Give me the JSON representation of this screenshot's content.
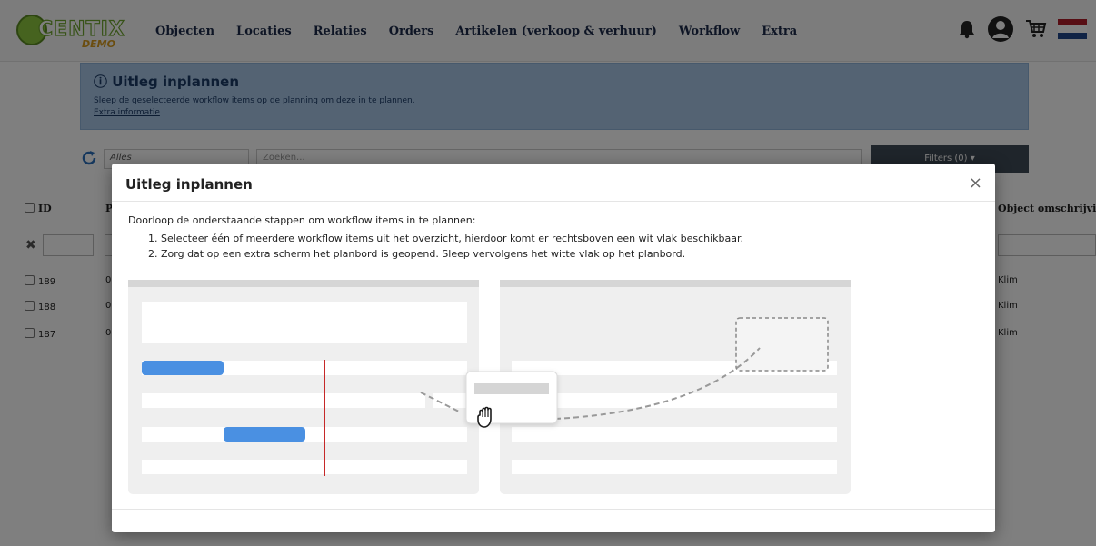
{
  "app": {
    "logo_text": "CENTIX",
    "logo_sub": "DEMO"
  },
  "nav": {
    "items": [
      {
        "label": "Objecten"
      },
      {
        "label": "Locaties"
      },
      {
        "label": "Relaties"
      },
      {
        "label": "Orders"
      },
      {
        "label": "Artikelen (verkoop & verhuur)"
      },
      {
        "label": "Workflow"
      },
      {
        "label": "Extra"
      }
    ],
    "icons": [
      "bell-icon",
      "user-avatar-icon",
      "cart-icon",
      "dutch-flag-icon"
    ]
  },
  "info": {
    "title": "Uitleg inplannen",
    "text": "Sleep de geselecteerde workflow items op de planning om deze in te plannen.",
    "link": "Extra informatie"
  },
  "toolbar": {
    "select_value": "Alles",
    "search_placeholder": "Zoeken...",
    "filters_label": "Filters (0) ▾"
  },
  "table": {
    "headers": {
      "id": "ID",
      "p": "P",
      "object": "Object omschrijvir"
    },
    "rows": [
      {
        "id": "189",
        "p": "0",
        "object": "Klim"
      },
      {
        "id": "188",
        "p": "0",
        "object": "Klim"
      },
      {
        "id": "187",
        "p": "0",
        "object": "Klim"
      }
    ]
  },
  "modal": {
    "title": "Uitleg inplannen",
    "close": "×",
    "intro": "Doorloop de onderstaande stappen om workflow items in te plannen:",
    "steps": [
      "1. Selecteer één of meerdere workflow items uit het overzicht, hierdoor komt er rechtsboven een wit vlak beschikbaar.",
      "2. Zorg dat op een extra scherm het planbord is geopend. Sleep vervolgens het witte vlak op het planbord."
    ]
  },
  "colors": {
    "nav_bg": "#f8f8f8",
    "info_bg": "#a8c6e6",
    "accent_blue": "#4a90e2",
    "timeline_red": "#c62828",
    "filter_btn": "#3f4a56"
  }
}
